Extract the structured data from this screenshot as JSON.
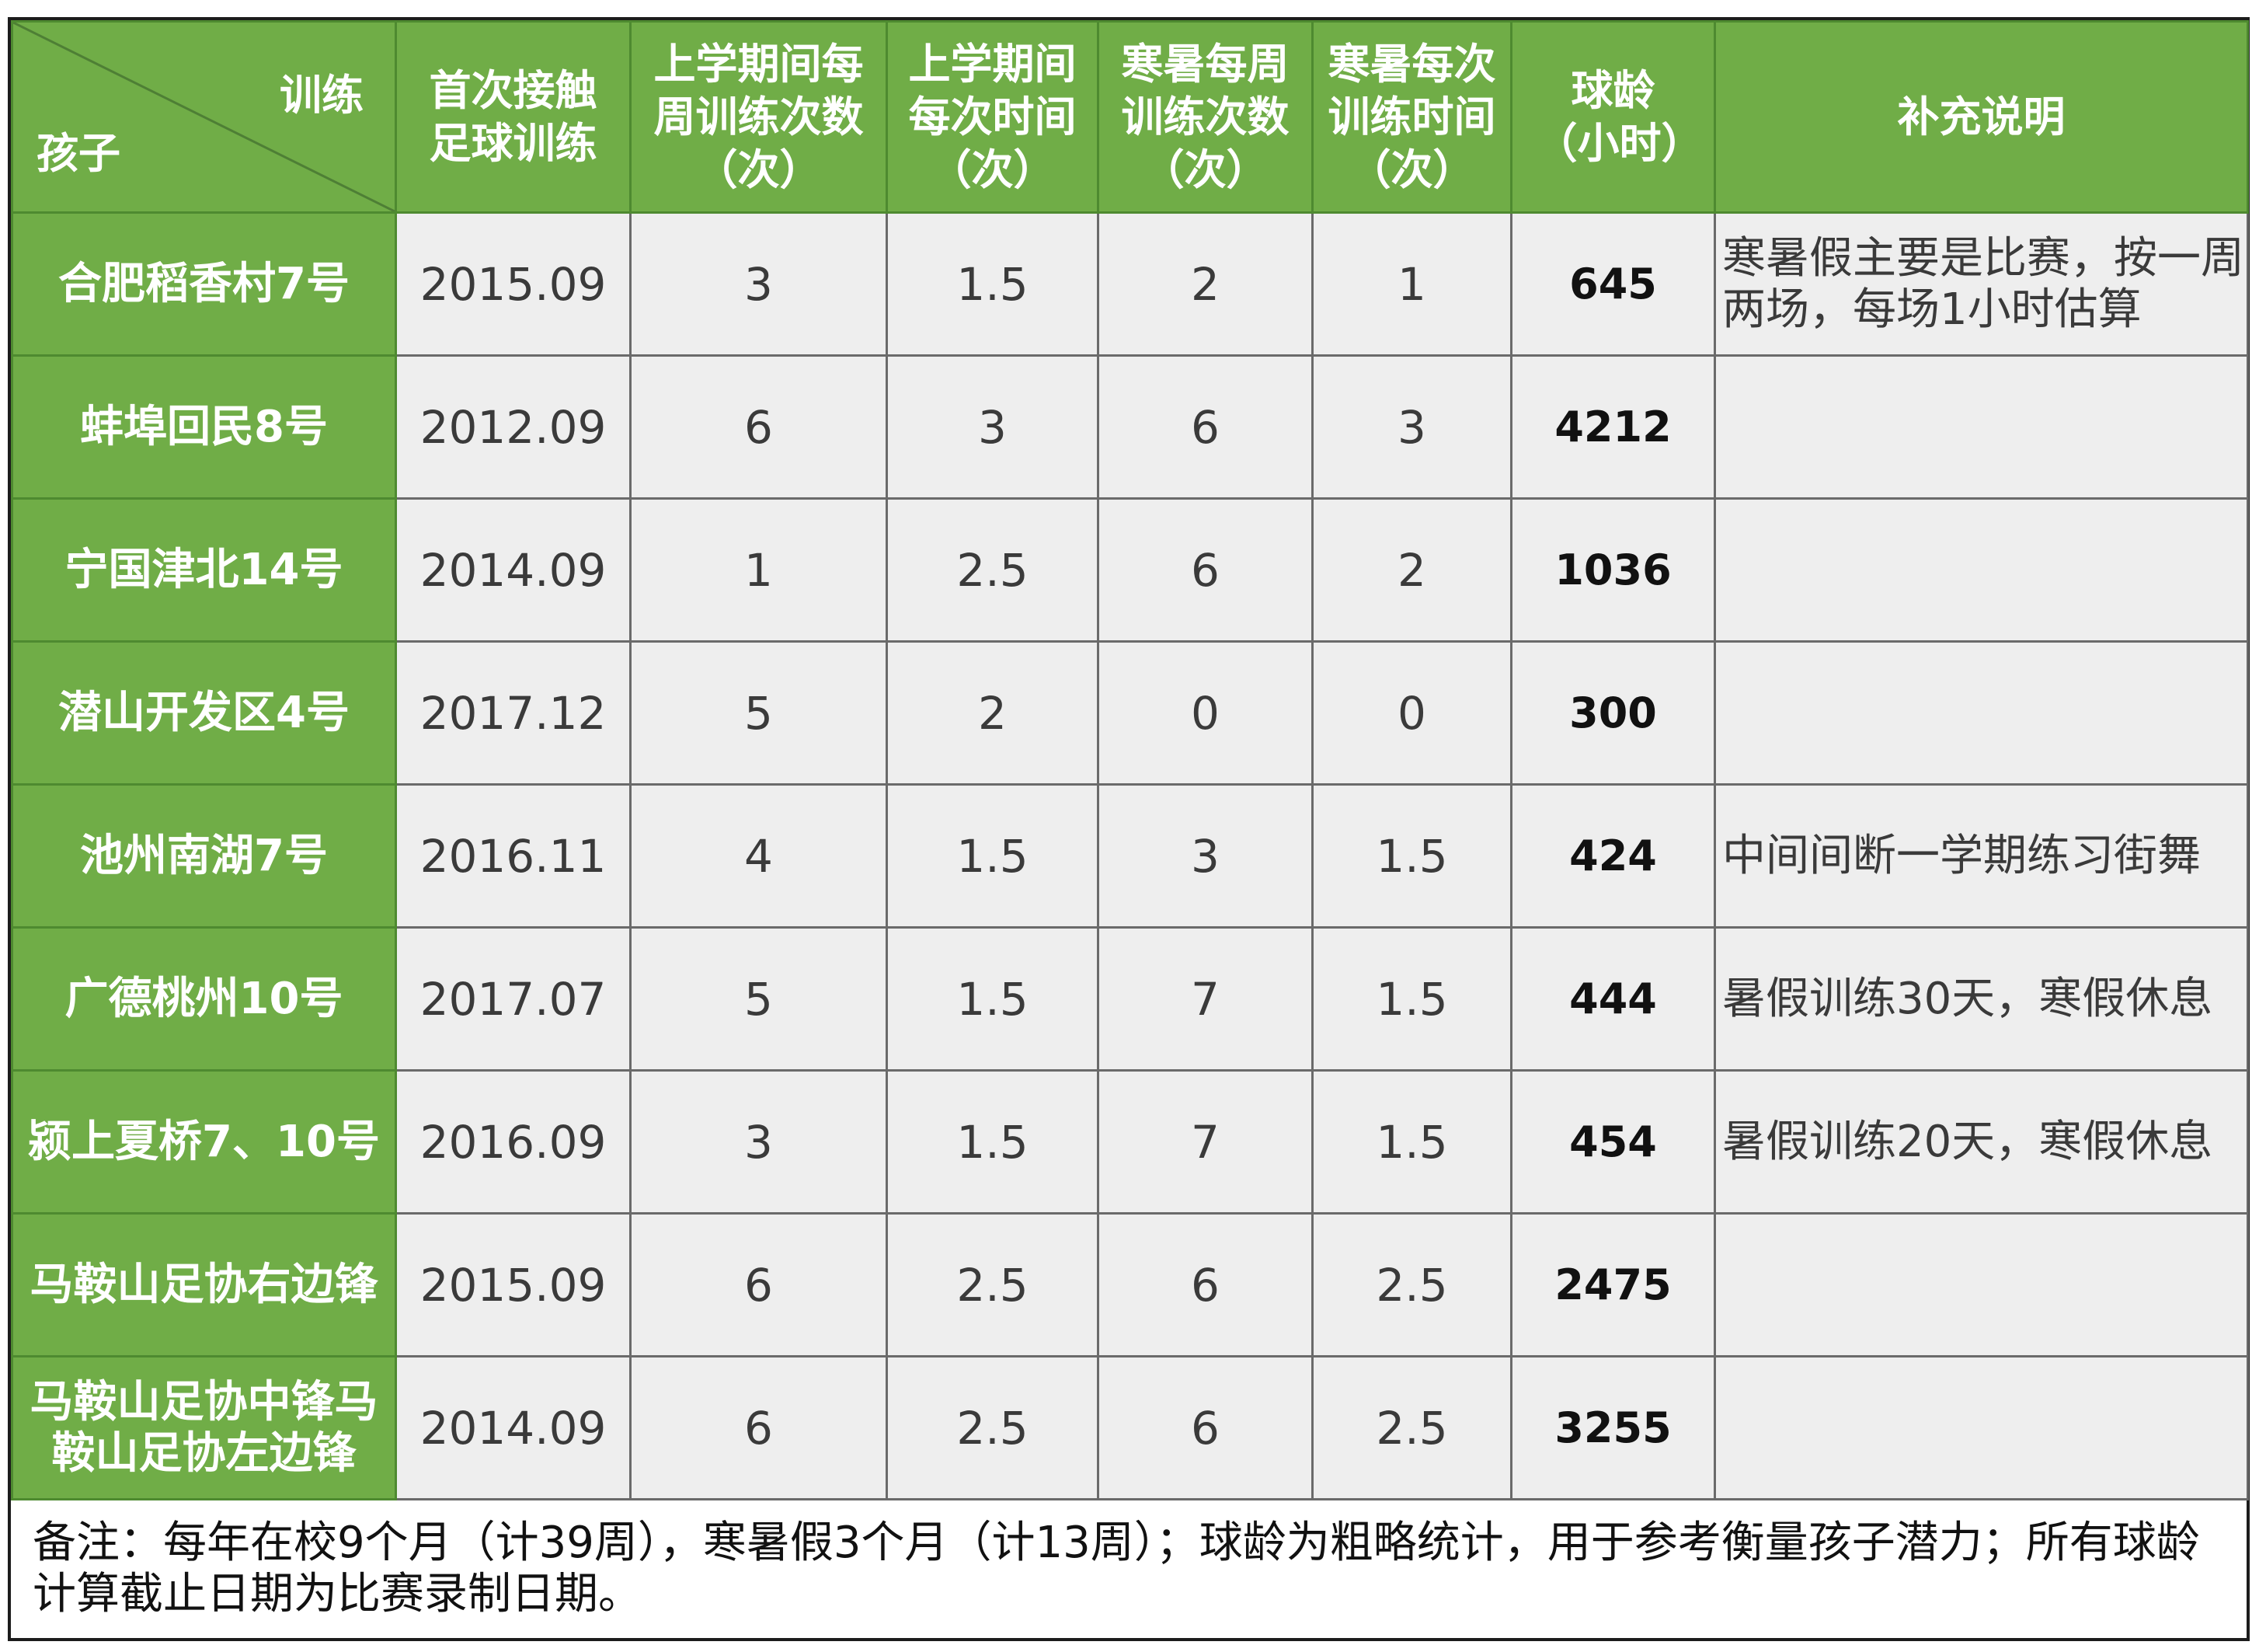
{
  "header": {
    "corner_top": "训练",
    "corner_bottom": "孩子",
    "columns": [
      "首次接触足球训练",
      "上学期间每周训练次数（次）",
      "上学期间每次时间（次）",
      "寒暑每周训练次数（次）",
      "寒暑每次训练时间（次）",
      "球龄（小时）",
      "补充说明"
    ]
  },
  "rows": [
    {
      "child": "合肥稻香村7号",
      "first": "2015.09",
      "school_weekly": "3",
      "school_each": "1.5",
      "vac_weekly": "2",
      "vac_each": "1",
      "age": "645",
      "note": "寒暑假主要是比赛，按一周两场，每场1小时估算"
    },
    {
      "child": "蚌埠回民8号",
      "first": "2012.09",
      "school_weekly": "6",
      "school_each": "3",
      "vac_weekly": "6",
      "vac_each": "3",
      "age": "4212",
      "note": ""
    },
    {
      "child": "宁国津北14号",
      "first": "2014.09",
      "school_weekly": "1",
      "school_each": "2.5",
      "vac_weekly": "6",
      "vac_each": "2",
      "age": "1036",
      "note": ""
    },
    {
      "child": "潜山开发区4号",
      "first": "2017.12",
      "school_weekly": "5",
      "school_each": "2",
      "vac_weekly": "0",
      "vac_each": "0",
      "age": "300",
      "note": ""
    },
    {
      "child": "池州南湖7号",
      "first": "2016.11",
      "school_weekly": "4",
      "school_each": "1.5",
      "vac_weekly": "3",
      "vac_each": "1.5",
      "age": "424",
      "note": "中间间断一学期练习街舞"
    },
    {
      "child": "广德桃州10号",
      "first": "2017.07",
      "school_weekly": "5",
      "school_each": "1.5",
      "vac_weekly": "7",
      "vac_each": "1.5",
      "age": "444",
      "note": "暑假训练30天，寒假休息"
    },
    {
      "child": "颍上夏桥7、10号",
      "first": "2016.09",
      "school_weekly": "3",
      "school_each": "1.5",
      "vac_weekly": "7",
      "vac_each": "1.5",
      "age": "454",
      "note": "暑假训练20天，寒假休息"
    },
    {
      "child": "马鞍山足协右边锋",
      "first": "2015.09",
      "school_weekly": "6",
      "school_each": "2.5",
      "vac_weekly": "6",
      "vac_each": "2.5",
      "age": "2475",
      "note": ""
    },
    {
      "child": "马鞍山足协中锋马鞍山足协左边锋",
      "first": "2014.09",
      "school_weekly": "6",
      "school_each": "2.5",
      "vac_weekly": "6",
      "vac_each": "2.5",
      "age": "3255",
      "note": ""
    }
  ],
  "footer": "备注：每年在校9个月（计39周），寒暑假3个月（计13周）；球龄为粗略统计，用于参考衡量孩子潜力；所有球龄计算截止日期为比赛录制日期。"
}
